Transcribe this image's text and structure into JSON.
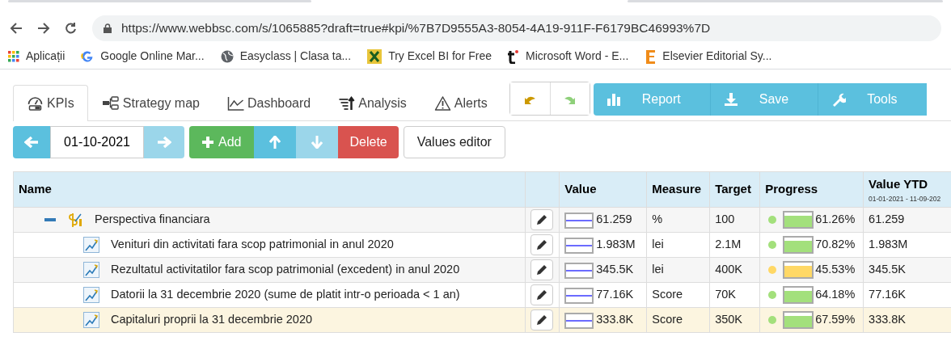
{
  "browser": {
    "url": "https://www.webbsc.com/s/1065885?draft=true#kpi/%7B7D9555A3-8054-4A19-911F-F6179BC46993%7D",
    "bookmarks": [
      {
        "kind": "apps",
        "label": "Aplicații"
      },
      {
        "kind": "google",
        "label": "Google Online Mar..."
      },
      {
        "kind": "globe",
        "label": "Easyclass | Clasa ta..."
      },
      {
        "kind": "excel",
        "label": "Try Excel BI for Free"
      },
      {
        "kind": "t",
        "label": "Microsoft Word - E..."
      },
      {
        "kind": "elsevier",
        "label": "Elsevier Editorial Sy..."
      }
    ]
  },
  "tabs": [
    {
      "kind": "gauge",
      "label": "KPIs",
      "selected": true
    },
    {
      "kind": "map",
      "label": "Strategy map",
      "selected": false
    },
    {
      "kind": "chart",
      "label": "Dashboard",
      "selected": false
    },
    {
      "kind": "sort",
      "label": "Analysis",
      "selected": false
    },
    {
      "kind": "alert",
      "label": "Alerts",
      "selected": false
    }
  ],
  "action_buttons": [
    {
      "kind": "report",
      "label": "Report"
    },
    {
      "kind": "save",
      "label": "Save"
    },
    {
      "kind": "tools",
      "label": "Tools"
    }
  ],
  "date": "01-10-2021",
  "edit_buttons": [
    {
      "kind": "add",
      "label": "Add"
    },
    {
      "kind": "up"
    },
    {
      "kind": "down"
    },
    {
      "kind": "delete",
      "label": "Delete"
    },
    {
      "kind": "plain",
      "label": "Values editor"
    }
  ],
  "table": {
    "columns": [
      {
        "label": "Name"
      },
      {},
      {
        "label": "Value"
      },
      {
        "label": "Measure"
      },
      {
        "label": "Target"
      },
      {
        "label": "Progress"
      },
      {
        "label": "Value YTD",
        "sub": "01-01-2021 - 11-09-202"
      }
    ],
    "rows": [
      {
        "kind": "perspective",
        "name": "Perspectiva financiara",
        "expanded": true,
        "selected": false,
        "value": "61.259",
        "measure": "%",
        "target": "100",
        "color": "#a3e07c",
        "progress_text": "61.26%",
        "ytd": "61.259",
        "children": [
          {
            "kind": "kpi",
            "name": "Venituri din activitati fara scop patrimonial in anul 2020",
            "selected": false,
            "value": "1.983M",
            "measure": "lei",
            "target": "2.1M",
            "color": "#a3e07c",
            "progress_text": "70.82%",
            "ytd": "1.983M"
          },
          {
            "kind": "kpi",
            "name": "Rezultatul activitatilor fara scop patrimonial (excedent) in anul 2020",
            "selected": false,
            "value": "345.5K",
            "measure": "lei",
            "target": "400K",
            "color": "#ffd866",
            "progress_text": "45.53%",
            "ytd": "345.5K"
          },
          {
            "kind": "kpi",
            "name": "Datorii la 31 decembrie 2020 (sume de platit intr-o perioada < 1 an)",
            "selected": false,
            "value": "77.16K",
            "measure": "Score",
            "target": "70K",
            "color": "#a3e07c",
            "progress_text": "64.18%",
            "ytd": "77.16K"
          },
          {
            "kind": "kpi",
            "name": "Capitaluri proprii la 31 decembrie 2020",
            "selected": true,
            "value": "333.8K",
            "measure": "Score",
            "target": "350K",
            "color": "#a3e07c",
            "progress_text": "67.59%",
            "ytd": "333.8K"
          }
        ]
      }
    ]
  }
}
